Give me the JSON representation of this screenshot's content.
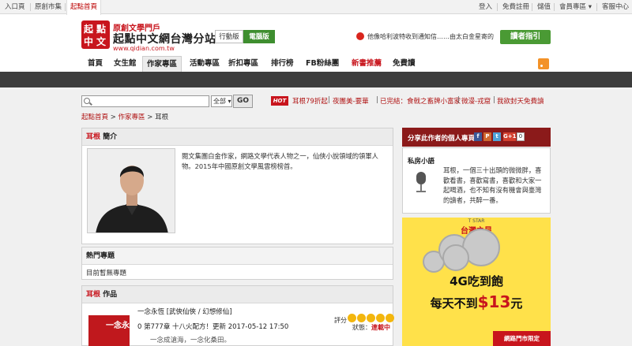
{
  "topbar": {
    "left": [
      "入口頁",
      "原創市集",
      "起點首頁"
    ],
    "right": [
      "登入",
      "免費註冊",
      "儲值",
      "會員專區 ▾",
      "客服中心"
    ]
  },
  "header": {
    "logo_chars": [
      "起",
      "點",
      "中",
      "文"
    ],
    "slogan": "原創文學門戶",
    "brand": "起點中文網台灣分站",
    "domain": "www.qidian.com.tw",
    "version_mobile": "行動版",
    "version_pc": "電腦版",
    "notice": "他像哈利波特收到通知信……由太白金星寄的",
    "guide_button": "讀者指引"
  },
  "nav": {
    "items": [
      "首頁",
      "女生館",
      "作家專區",
      "活動專區",
      "折扣專區",
      "排行榜",
      "FB粉絲團",
      "新書推薦",
      "免費讀"
    ]
  },
  "search": {
    "select_value": "全部",
    "button": "GO"
  },
  "hot": {
    "badge": "HOT",
    "links": [
      "耳根79折起",
      "夜團美-要華",
      "已完結：食戟之畜牌小富家",
      "微漫-戎窟",
      "我欲封天免費讀"
    ]
  },
  "breadcrumb": [
    "起點首頁",
    "作家專區",
    "耳根"
  ],
  "intro_panel": {
    "author": "耳根",
    "title_suffix": "簡介",
    "text": "閱文集團白金作家，網路文學代表人物之一，仙俠小說領域的領軍人物。2015年中國原創文學風雲榜榜首。"
  },
  "topic_panel": {
    "title": "熱門專題",
    "empty": "目前暫無專題"
  },
  "works_panel": {
    "author": "耳根",
    "title_suffix": "作品",
    "items": [
      {
        "title": "一念永恆 [武俠仙俠 / 幻想修仙]",
        "cover_text": "一念永",
        "info": "0  第777章 十八火配方！更新 2017-05-12 17:50",
        "desc": "一念成滄海，一念化桑田。",
        "rating_label": "評分",
        "stars": 5,
        "status_label": "狀態：",
        "status_value": "連載中"
      }
    ]
  },
  "sidebar": {
    "share_title": "分享此作者的個人專頁",
    "social": [
      "f",
      "P",
      "t",
      "G+1"
    ],
    "share_count": "0",
    "diary_title": "私房小語",
    "diary_text": "耳根，一個三十出頭的微微胖，喜歡看書，喜歡寫書，喜歡和大家一起喝酒，也不知有沒有機會與臺灣的讀者，共醉一番。"
  },
  "ad": {
    "top": "T STAR",
    "brand": "台灣之星",
    "line1": "4G吃到飽",
    "line2_prefix": "每天不到",
    "line2_value": "$13",
    "line2_suffix": "元",
    "footer": "網路門市限定"
  },
  "colors": {
    "brand_red": "#c8151d",
    "green": "#3e8e2f",
    "dark_nav": "#3c3c3c",
    "share_bar": "#8b1a1a"
  }
}
